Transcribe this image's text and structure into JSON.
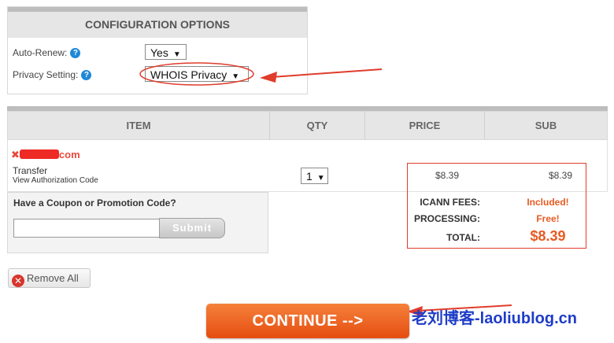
{
  "config": {
    "title": "CONFIGURATION OPTIONS",
    "auto_renew_label": "Auto-Renew:",
    "auto_renew_value": "Yes",
    "privacy_label": "Privacy Setting:",
    "privacy_value": "WHOIS Privacy",
    "help_glyph": "?"
  },
  "table": {
    "headers": [
      "ITEM",
      "QTY",
      "PRICE",
      "SUB"
    ],
    "row": {
      "domain_prefix": "✖",
      "domain_suffix": "com",
      "type": "Transfer",
      "auth_link": "View Authorization Code",
      "qty": "1",
      "price": "$8.39",
      "sub": "$8.39"
    }
  },
  "fees": {
    "icann_label": "ICANN FEES:",
    "icann_value": "Included!",
    "processing_label": "PROCESSING:",
    "processing_value": "Free!",
    "total_label": "TOTAL:",
    "total_value": "$8.39"
  },
  "coupon": {
    "title": "Have a Coupon or Promotion Code?",
    "input_value": "",
    "submit_label": "Submit"
  },
  "actions": {
    "remove_all_label": "Remove All",
    "continue_label": "CONTINUE -->"
  },
  "watermark": "老刘博客-laoliublog.cn",
  "colors": {
    "accent_orange": "#e85a22",
    "annotation_red": "#e03c2c",
    "watermark_blue": "#1e3cc8"
  }
}
